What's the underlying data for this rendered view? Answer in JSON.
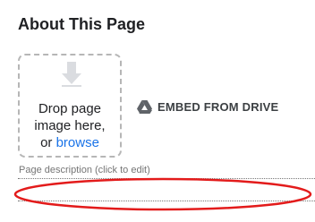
{
  "section": {
    "title": "About This Page"
  },
  "dropzone": {
    "line1": "Drop page",
    "line2": "image here,",
    "line3_prefix": "or",
    "browse_label": "browse",
    "icon": "download-arrow-icon"
  },
  "embed": {
    "label": "EMBED FROM DRIVE",
    "icon": "google-drive-icon"
  },
  "description": {
    "label": "Page description (click to edit)",
    "value": ""
  },
  "colors": {
    "link": "#1a73e8",
    "highlight": "#e31b1b",
    "dashed_border": "#b6b6b6"
  }
}
